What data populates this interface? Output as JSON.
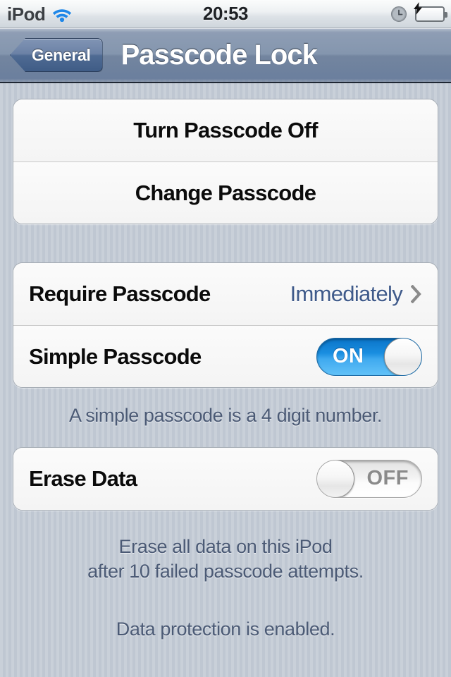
{
  "status_bar": {
    "carrier": "iPod",
    "wifi_icon": "wifi-icon",
    "time": "20:53",
    "alarm_icon": "alarm-clock-icon",
    "battery_icon": "battery-charging-icon"
  },
  "nav_bar": {
    "back_label": "General",
    "title": "Passcode Lock"
  },
  "groups": [
    {
      "rows": [
        {
          "label": "Turn Passcode Off"
        },
        {
          "label": "Change Passcode"
        }
      ]
    },
    {
      "rows": [
        {
          "label": "Require Passcode",
          "value": "Immediately",
          "accessory": "chevron-right-icon"
        },
        {
          "label": "Simple Passcode",
          "switch_state": "ON"
        }
      ]
    },
    {
      "rows": [
        {
          "label": "Erase Data",
          "switch_state": "OFF"
        }
      ]
    }
  ],
  "footers": {
    "simple_passcode": "A simple passcode is a 4 digit number.",
    "erase_line_1": "Erase all data on this iPod",
    "erase_line_2": "after 10 failed passcode attempts.",
    "data_protection": "Data protection is enabled."
  },
  "colors": {
    "accent_blue": "#1a8ee0",
    "value_text": "#3f5a8a",
    "footer_text": "#4b5a75",
    "navbar": "#73859f",
    "wallpaper": "#c3cbd5"
  }
}
